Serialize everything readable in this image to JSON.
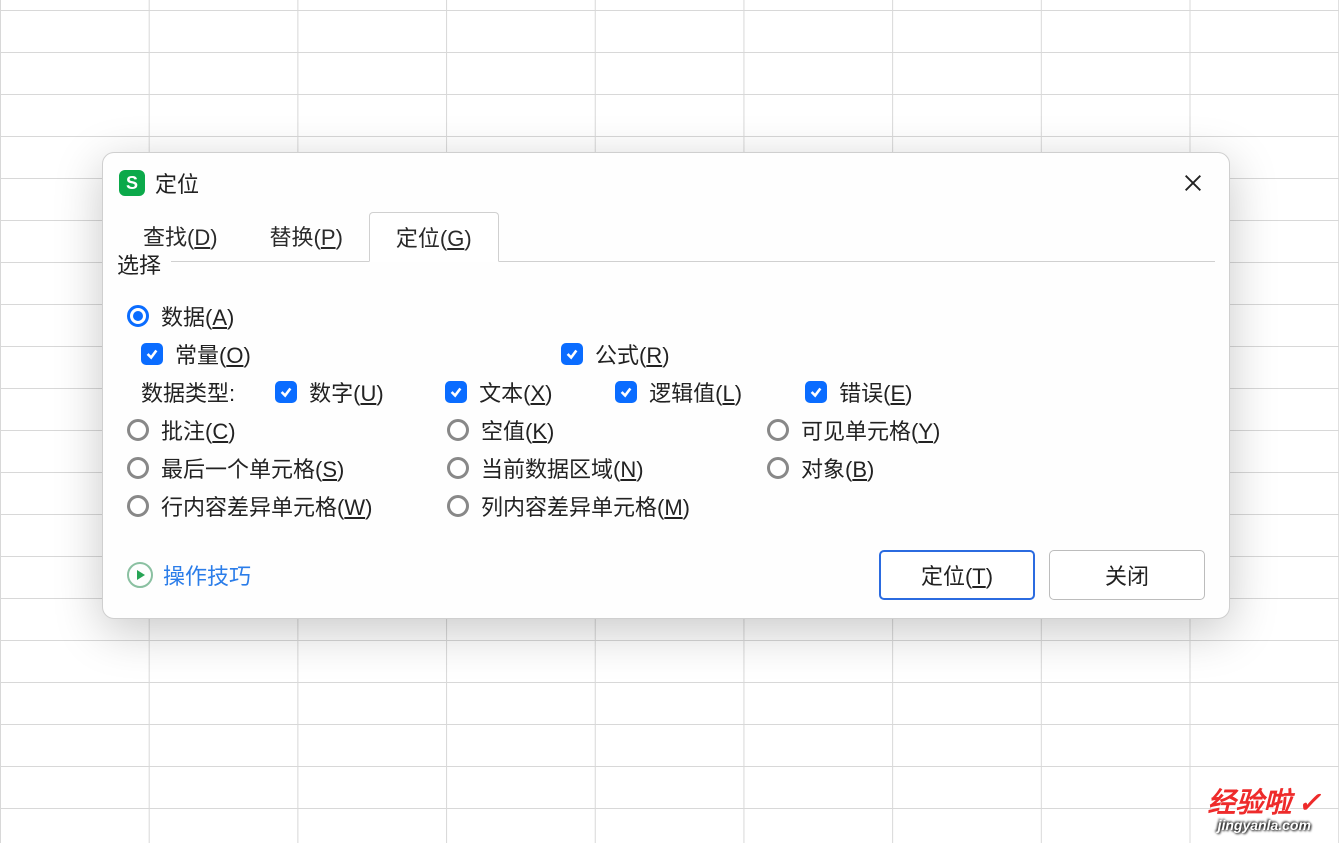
{
  "dialog": {
    "title": "定位",
    "tabs": {
      "find": {
        "text": "查找(",
        "hotkey": "D",
        "suffix": ")"
      },
      "replace": {
        "text": "替换(",
        "hotkey": "P",
        "suffix": ")"
      },
      "goto": {
        "text": "定位(",
        "hotkey": "G",
        "suffix": ")"
      }
    },
    "section_label": "选择",
    "radios": {
      "data": {
        "text": "数据(",
        "hotkey": "A",
        "suffix": ")"
      },
      "comment": {
        "text": "批注(",
        "hotkey": "C",
        "suffix": ")"
      },
      "blank": {
        "text": "空值(",
        "hotkey": "K",
        "suffix": ")"
      },
      "visible": {
        "text": "可见单元格(",
        "hotkey": "Y",
        "suffix": ")"
      },
      "lastcell": {
        "text": "最后一个单元格(",
        "hotkey": "S",
        "suffix": ")"
      },
      "region": {
        "text": "当前数据区域(",
        "hotkey": "N",
        "suffix": ")"
      },
      "object": {
        "text": "对象(",
        "hotkey": "B",
        "suffix": ")"
      },
      "rowdiff": {
        "text": "行内容差异单元格(",
        "hotkey": "W",
        "suffix": ")"
      },
      "coldiff": {
        "text": "列内容差异单元格(",
        "hotkey": "M",
        "suffix": ")"
      }
    },
    "checks": {
      "constant": {
        "text": "常量(",
        "hotkey": "O",
        "suffix": ")"
      },
      "formula": {
        "text": "公式(",
        "hotkey": "R",
        "suffix": ")"
      },
      "number": {
        "text": "数字(",
        "hotkey": "U",
        "suffix": ")"
      },
      "text_": {
        "text": "文本(",
        "hotkey": "X",
        "suffix": ")"
      },
      "logic": {
        "text": "逻辑值(",
        "hotkey": "L",
        "suffix": ")"
      },
      "error": {
        "text": "错误(",
        "hotkey": "E",
        "suffix": ")"
      }
    },
    "data_type_label": "数据类型:",
    "tips_link": "操作技巧",
    "buttons": {
      "goto": {
        "text": "定位(",
        "hotkey": "T",
        "suffix": ")"
      },
      "close": "关闭"
    }
  },
  "watermark": {
    "top": "经验啦",
    "bottom": "jingyanla.com"
  }
}
